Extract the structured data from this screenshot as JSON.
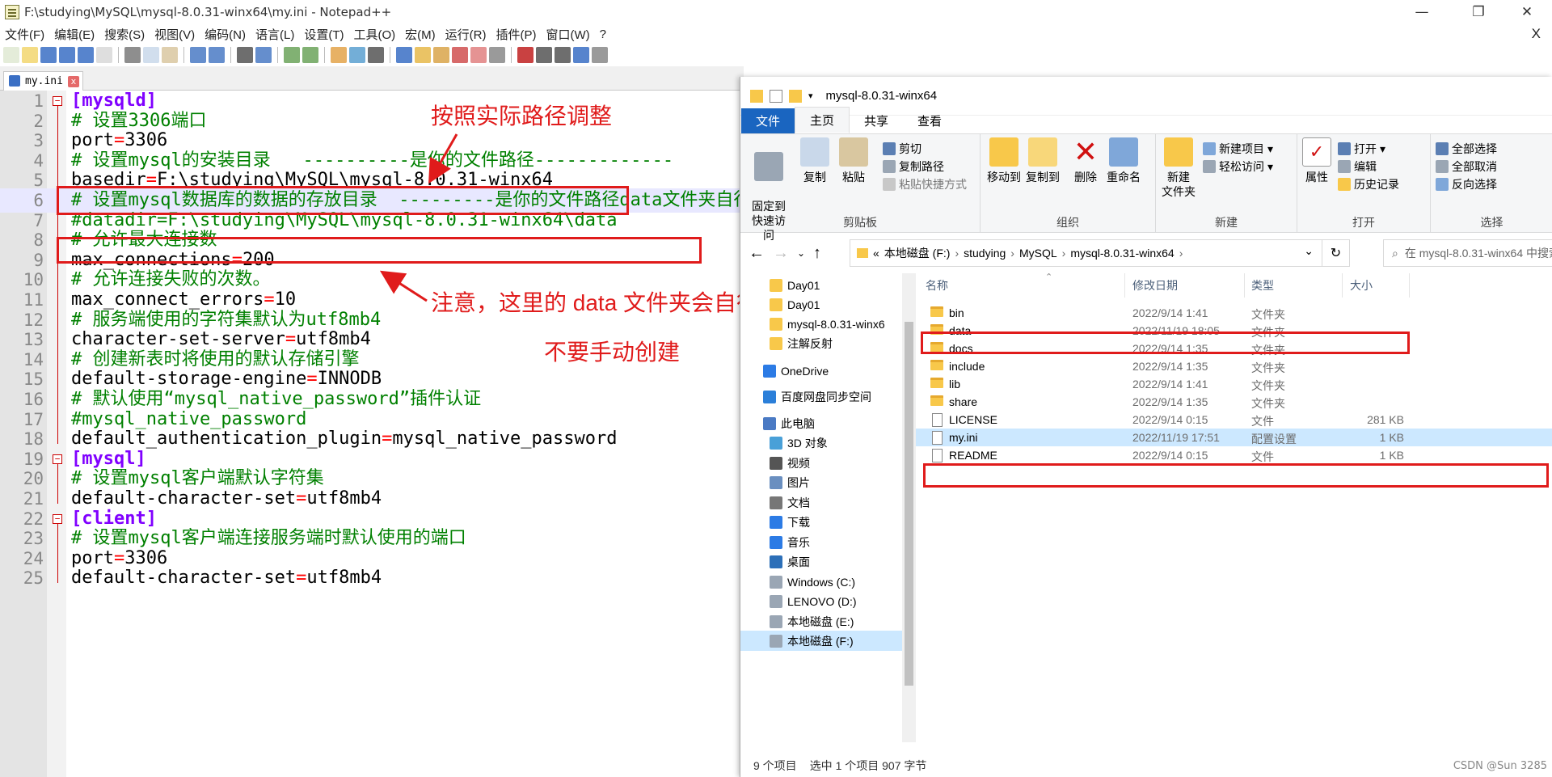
{
  "notepad": {
    "title": "F:\\studying\\MySQL\\mysql-8.0.31-winx64\\my.ini - Notepad++",
    "menu": [
      "文件(F)",
      "编辑(E)",
      "搜索(S)",
      "视图(V)",
      "编码(N)",
      "语言(L)",
      "设置(T)",
      "工具(O)",
      "宏(M)",
      "运行(R)",
      "插件(P)",
      "窗口(W)",
      "?"
    ],
    "menu_close": "X",
    "window_min": "—",
    "window_max": "❐",
    "window_close": "✕",
    "tab": {
      "label": "my.ini",
      "close": "x"
    },
    "lines": [
      {
        "n": "1",
        "parts": [
          {
            "t": "[mysqld]",
            "c": "sec"
          }
        ],
        "fold": "start"
      },
      {
        "n": "2",
        "parts": [
          {
            "t": "# 设置3306端口",
            "c": "cmt"
          }
        ]
      },
      {
        "n": "3",
        "parts": [
          {
            "t": "port",
            "c": "key"
          },
          {
            "t": "=",
            "c": "eq"
          },
          {
            "t": "3306",
            "c": "val"
          }
        ]
      },
      {
        "n": "4",
        "parts": [
          {
            "t": "# 设置mysql的安装目录   ----------是你的文件路径-------------",
            "c": "cmt"
          }
        ]
      },
      {
        "n": "5",
        "parts": [
          {
            "t": "basedir",
            "c": "key"
          },
          {
            "t": "=",
            "c": "eq"
          },
          {
            "t": "F:\\studying\\MySQL\\mysql-8.0.31-winx64",
            "c": "val"
          }
        ]
      },
      {
        "n": "6",
        "parts": [
          {
            "t": "# 设置mysql数据库的数据的存放目录  ---------是你的文件路径data文件夹自行创建",
            "c": "cmt"
          }
        ],
        "cur": true
      },
      {
        "n": "7",
        "parts": [
          {
            "t": "#datadir=F:\\studying\\MySQL\\mysql-8.0.31-winx64\\data",
            "c": "cmt"
          }
        ]
      },
      {
        "n": "8",
        "parts": [
          {
            "t": "# 允许最大连接数",
            "c": "cmt"
          }
        ]
      },
      {
        "n": "9",
        "parts": [
          {
            "t": "max_connections",
            "c": "key"
          },
          {
            "t": "=",
            "c": "eq"
          },
          {
            "t": "200",
            "c": "val"
          }
        ]
      },
      {
        "n": "10",
        "parts": [
          {
            "t": "# 允许连接失败的次数。",
            "c": "cmt"
          }
        ]
      },
      {
        "n": "11",
        "parts": [
          {
            "t": "max_connect_errors",
            "c": "key"
          },
          {
            "t": "=",
            "c": "eq"
          },
          {
            "t": "10",
            "c": "val"
          }
        ]
      },
      {
        "n": "12",
        "parts": [
          {
            "t": "# 服务端使用的字符集默认为utf8mb4",
            "c": "cmt"
          }
        ]
      },
      {
        "n": "13",
        "parts": [
          {
            "t": "character-set-server",
            "c": "key"
          },
          {
            "t": "=",
            "c": "eq"
          },
          {
            "t": "utf8mb4",
            "c": "val"
          }
        ]
      },
      {
        "n": "14",
        "parts": [
          {
            "t": "# 创建新表时将使用的默认存储引擎",
            "c": "cmt"
          }
        ]
      },
      {
        "n": "15",
        "parts": [
          {
            "t": "default-storage-engine",
            "c": "key"
          },
          {
            "t": "=",
            "c": "eq"
          },
          {
            "t": "INNODB",
            "c": "val"
          }
        ]
      },
      {
        "n": "16",
        "parts": [
          {
            "t": "# 默认使用“mysql_native_password”插件认证",
            "c": "cmt"
          }
        ]
      },
      {
        "n": "17",
        "parts": [
          {
            "t": "#mysql_native_password",
            "c": "cmt"
          }
        ]
      },
      {
        "n": "18",
        "parts": [
          {
            "t": "default_authentication_plugin",
            "c": "key"
          },
          {
            "t": "=",
            "c": "eq"
          },
          {
            "t": "mysql_native_password",
            "c": "val"
          }
        ],
        "fold": "end"
      },
      {
        "n": "19",
        "parts": [
          {
            "t": "[mysql]",
            "c": "sec"
          }
        ],
        "fold": "start"
      },
      {
        "n": "20",
        "parts": [
          {
            "t": "# 设置mysql客户端默认字符集",
            "c": "cmt"
          }
        ]
      },
      {
        "n": "21",
        "parts": [
          {
            "t": "default-character-set",
            "c": "key"
          },
          {
            "t": "=",
            "c": "eq"
          },
          {
            "t": "utf8mb4",
            "c": "val"
          }
        ],
        "fold": "end"
      },
      {
        "n": "22",
        "parts": [
          {
            "t": "[client]",
            "c": "sec"
          }
        ],
        "fold": "start"
      },
      {
        "n": "23",
        "parts": [
          {
            "t": "# 设置mysql客户端连接服务端时默认使用的端口",
            "c": "cmt"
          }
        ]
      },
      {
        "n": "24",
        "parts": [
          {
            "t": "port",
            "c": "key"
          },
          {
            "t": "=",
            "c": "eq"
          },
          {
            "t": "3306",
            "c": "val"
          }
        ]
      },
      {
        "n": "25",
        "parts": [
          {
            "t": "default-character-set",
            "c": "key"
          },
          {
            "t": "=",
            "c": "eq"
          },
          {
            "t": "utf8mb4",
            "c": "val"
          }
        ],
        "fold": "end"
      }
    ]
  },
  "annotations": {
    "path_note": "按照实际路径调整",
    "data_note": "注意，这里的 data 文件夹会自行创建",
    "manual_note": "不要手动创建"
  },
  "explorer": {
    "title": "mysql-8.0.31-winx64",
    "ribbon_tabs": [
      "文件",
      "主页",
      "共享",
      "查看"
    ],
    "groups": {
      "clipboard": {
        "label": "剪贴板",
        "pin": "固定到\n快速访问",
        "copy": "复制",
        "paste": "粘贴",
        "cut": "剪切",
        "copy_path": "复制路径",
        "paste_shortcut": "粘贴快捷方式"
      },
      "organize": {
        "label": "组织",
        "move_to": "移动到",
        "copy_to": "复制到",
        "delete": "删除",
        "rename": "重命名"
      },
      "new": {
        "label": "新建",
        "new_folder": "新建\n文件夹",
        "new_item": "新建项目",
        "easy_access": "轻松访问"
      },
      "open": {
        "label": "打开",
        "properties": "属性",
        "open": "打开",
        "edit": "编辑",
        "history": "历史记录"
      },
      "select": {
        "label": "选择",
        "select_all": "全部选择",
        "select_none": "全部取消",
        "invert": "反向选择"
      }
    },
    "address": {
      "root": "«",
      "crumbs": [
        "本地磁盘 (F:)",
        "studying",
        "MySQL",
        "mysql-8.0.31-winx64"
      ],
      "search_placeholder": "在 mysql-8.0.31-winx64 中搜索"
    },
    "nav_items": [
      {
        "label": "Day01",
        "icon": "folder"
      },
      {
        "label": "Day01",
        "icon": "folder"
      },
      {
        "label": "mysql-8.0.31-winx6",
        "icon": "folder"
      },
      {
        "label": "注解反射",
        "icon": "folder"
      },
      {
        "label": "OneDrive",
        "icon": "cloud"
      },
      {
        "label": "百度网盘同步空间",
        "icon": "baidu"
      },
      {
        "label": "此电脑",
        "icon": "pc"
      },
      {
        "label": "3D 对象",
        "icon": "3d"
      },
      {
        "label": "视频",
        "icon": "video"
      },
      {
        "label": "图片",
        "icon": "picture"
      },
      {
        "label": "文档",
        "icon": "doc"
      },
      {
        "label": "下载",
        "icon": "download"
      },
      {
        "label": "音乐",
        "icon": "music"
      },
      {
        "label": "桌面",
        "icon": "desktop"
      },
      {
        "label": "Windows (C:)",
        "icon": "drive"
      },
      {
        "label": "LENOVO (D:)",
        "icon": "drive"
      },
      {
        "label": "本地磁盘 (E:)",
        "icon": "drive"
      },
      {
        "label": "本地磁盘 (F:)",
        "icon": "drive",
        "selected": true
      }
    ],
    "columns": [
      "名称",
      "修改日期",
      "类型",
      "大小"
    ],
    "files": [
      {
        "name": "bin",
        "date": "2022/9/14 1:41",
        "type": "文件夹",
        "size": "",
        "folder": true
      },
      {
        "name": "data",
        "date": "2022/11/19 18:05",
        "type": "文件夹",
        "size": "",
        "folder": true
      },
      {
        "name": "docs",
        "date": "2022/9/14 1:35",
        "type": "文件夹",
        "size": "",
        "folder": true
      },
      {
        "name": "include",
        "date": "2022/9/14 1:35",
        "type": "文件夹",
        "size": "",
        "folder": true
      },
      {
        "name": "lib",
        "date": "2022/9/14 1:41",
        "type": "文件夹",
        "size": "",
        "folder": true
      },
      {
        "name": "share",
        "date": "2022/9/14 1:35",
        "type": "文件夹",
        "size": "",
        "folder": true
      },
      {
        "name": "LICENSE",
        "date": "2022/9/14 0:15",
        "type": "文件",
        "size": "281 KB",
        "folder": false
      },
      {
        "name": "my.ini",
        "date": "2022/11/19 17:51",
        "type": "配置设置",
        "size": "1 KB",
        "folder": false,
        "selected": true
      },
      {
        "name": "README",
        "date": "2022/9/14 0:15",
        "type": "文件",
        "size": "1 KB",
        "folder": false
      }
    ],
    "status": {
      "count": "9 个项目",
      "selected": "选中 1 个项目  907 字节"
    }
  },
  "watermark": "CSDN @Sun 3285",
  "colors": {
    "annotation_red": "#e01b1b",
    "comment_green": "#008000",
    "section_purple": "#8000ff",
    "ribbon_file_blue": "#1a65c0",
    "selection_blue": "#cce8ff"
  }
}
